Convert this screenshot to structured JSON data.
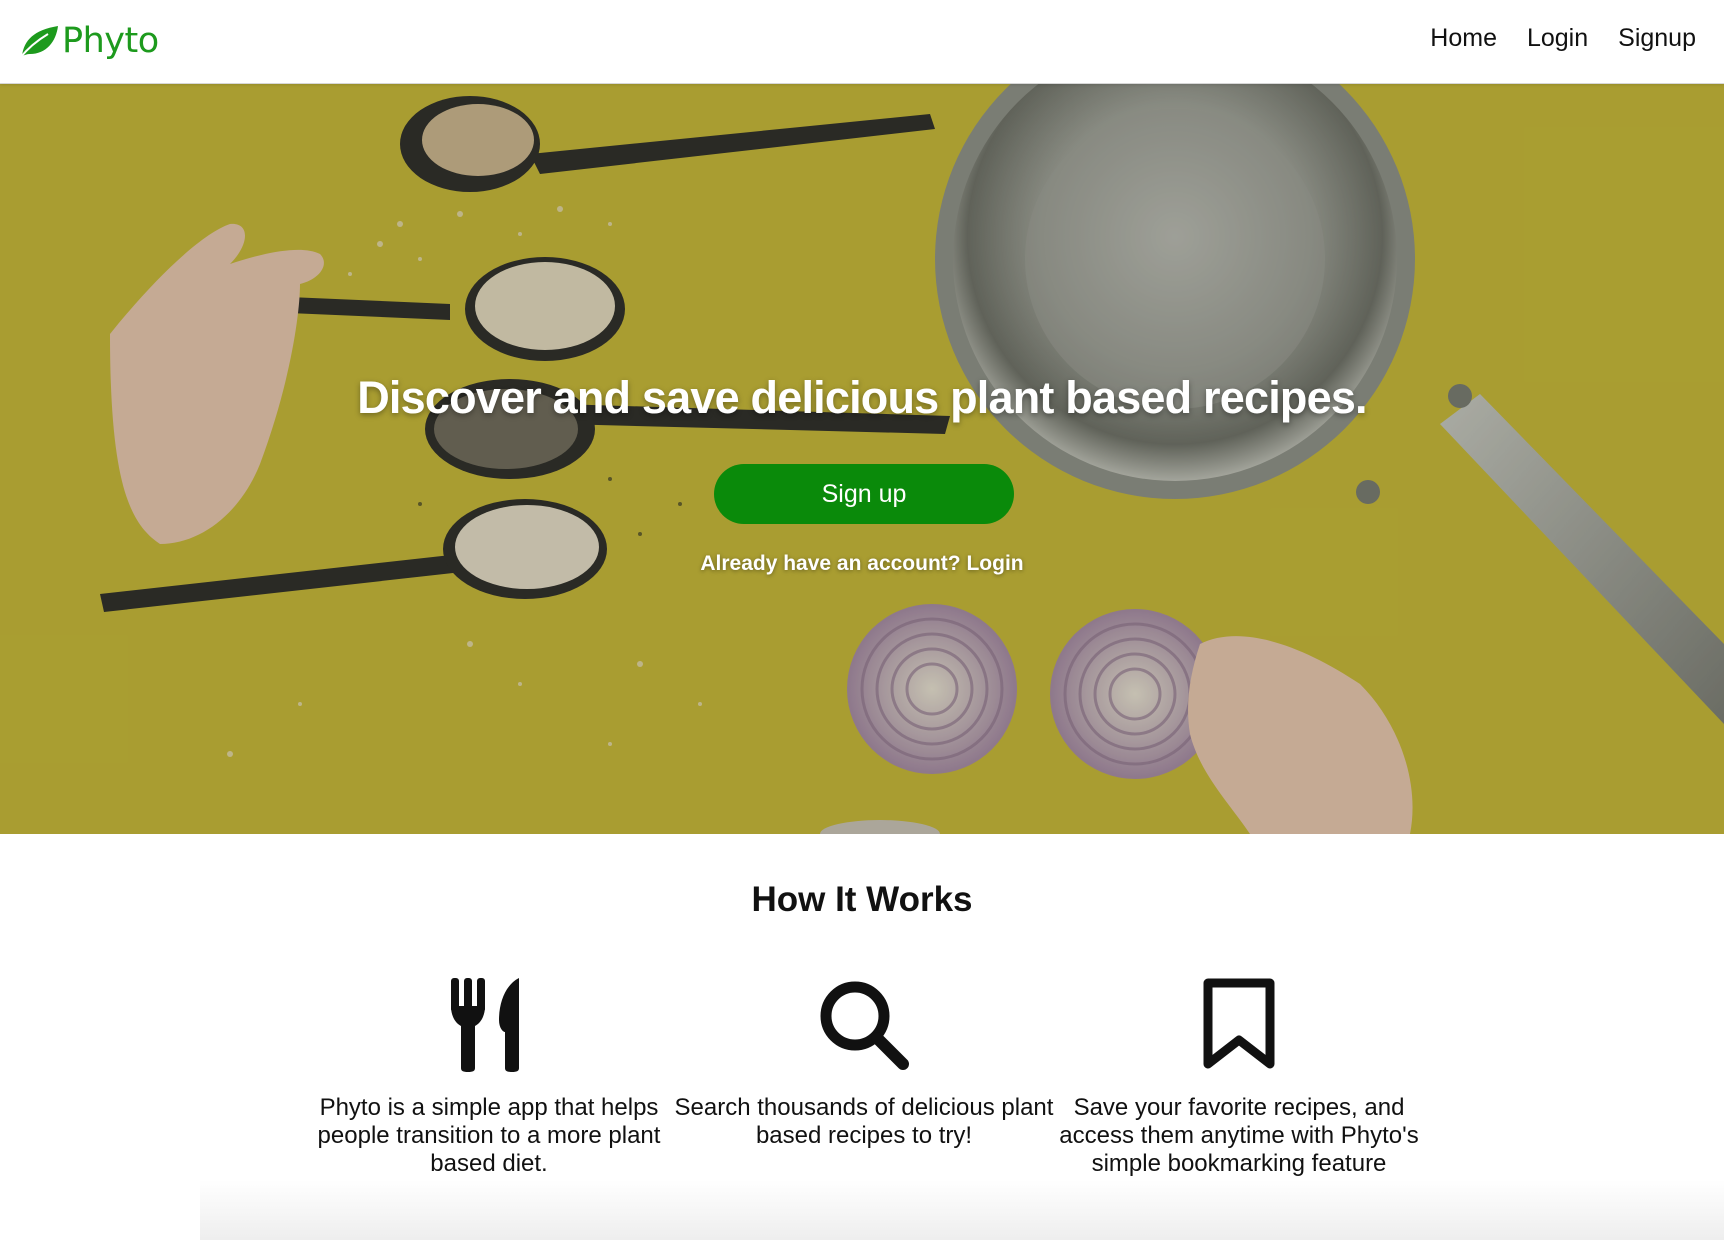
{
  "brand": {
    "name": "Phyto",
    "color": "#1d9a1d",
    "icon": "leaf-icon"
  },
  "nav": {
    "items": [
      {
        "label": "Home"
      },
      {
        "label": "Login"
      },
      {
        "label": "Signup"
      }
    ]
  },
  "hero": {
    "title": "Discover and save delicious plant based recipes.",
    "cta_label": "Sign up",
    "login_prompt": "Already have an account?",
    "login_link": "Login",
    "accent": "#0a8a0a",
    "background": "yellow tabletop with spoons of grains, a steel pan and onion slices"
  },
  "how": {
    "title": "How It Works",
    "features": [
      {
        "icon": "fork-knife-icon",
        "text": "Phyto is a simple app that helps people transition to a more plant based diet."
      },
      {
        "icon": "search-icon",
        "text": "Search thousands of delicious plant based recipes to try!"
      },
      {
        "icon": "bookmark-icon",
        "text": "Save your favorite recipes, and access them anytime with Phyto's simple bookmarking feature"
      }
    ]
  }
}
